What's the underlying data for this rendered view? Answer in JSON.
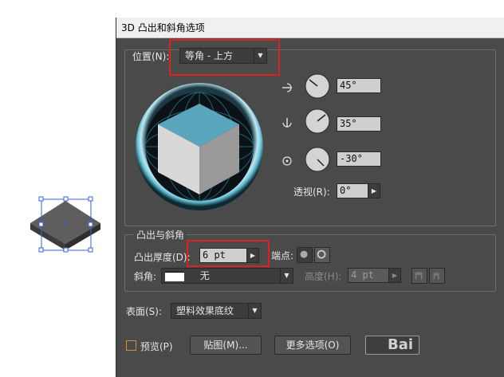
{
  "dialog": {
    "title": "3D 凸出和斜角选项"
  },
  "position": {
    "label": "位置(N):",
    "preset": "等角 - 上方",
    "rotation_x": "45°",
    "rotation_y": "35°",
    "rotation_z": "-30°",
    "perspective_label": "透视(R):",
    "perspective": "0°"
  },
  "extrude": {
    "group_label": "凸出与斜角",
    "depth_label": "凸出厚度(D):",
    "depth": "6 pt",
    "cap_label": "端点:",
    "bevel_label": "斜角:",
    "bevel": "无",
    "height_label": "高度(H):",
    "height": "4 pt"
  },
  "surface": {
    "label": "表面(S):",
    "value": "塑料效果底纹"
  },
  "footer": {
    "preview_label": "预览(P)",
    "map_button": "贴图(M)...",
    "more_button": "更多选项(O)",
    "watermark": "Bai"
  },
  "colors": {
    "cube_top": "#5aa6bd",
    "highlight": "#e02020",
    "dialog_bg": "#4a4a4a"
  }
}
